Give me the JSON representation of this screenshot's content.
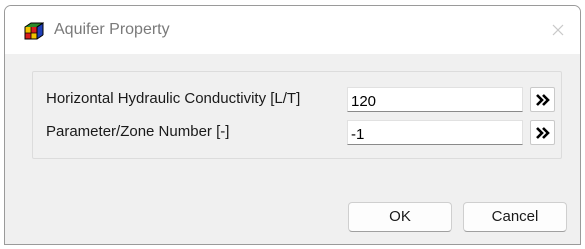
{
  "window": {
    "title": "Aquifer Property",
    "icon": "app-cube-icon",
    "close_icon": "close-icon"
  },
  "form": {
    "rows": [
      {
        "label": "Horizontal Hydraulic Conductivity [L/T]",
        "value": "120",
        "button_icon": "double-chevron-right-icon"
      },
      {
        "label": "Parameter/Zone Number [-]",
        "value": "-1",
        "button_icon": "double-chevron-right-icon"
      }
    ]
  },
  "buttons": {
    "ok_label": "OK",
    "cancel_label": "Cancel"
  },
  "colors": {
    "window_bg": "#f0f0f0",
    "titlebar_bg": "#ffffff",
    "title_text": "#7a7a7a"
  }
}
